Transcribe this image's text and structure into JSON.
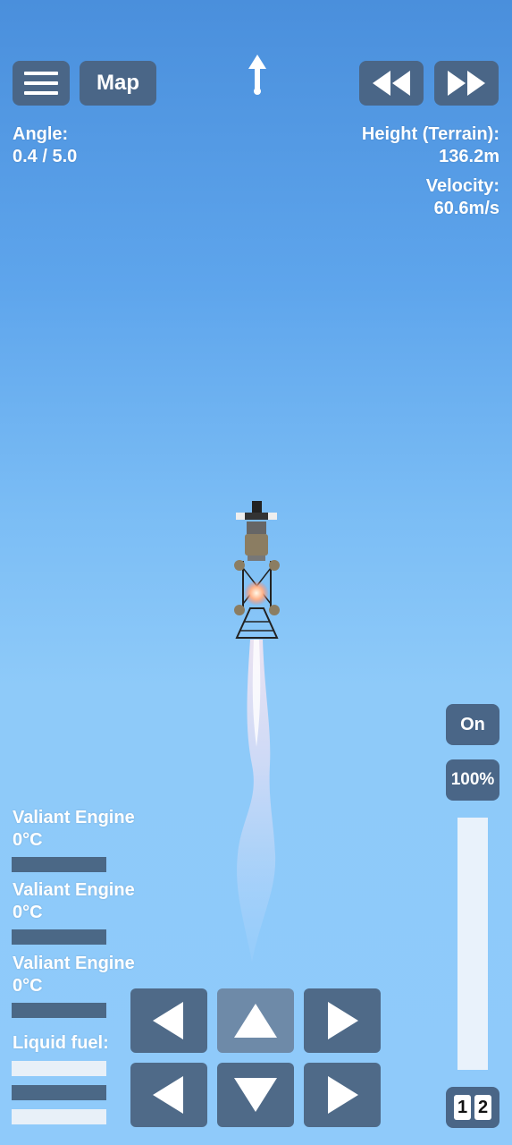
{
  "top_bar": {
    "menu_icon": "hamburger-menu-icon",
    "map_label": "Map",
    "heading_icon": "heading-arrow-up-icon",
    "rewind_icon": "rewind-icon",
    "fast_forward_icon": "fast-forward-icon"
  },
  "telemetry": {
    "angle_label": "Angle:",
    "angle_value": "0.4 / 5.0",
    "height_label": "Height (Terrain):",
    "height_value": "136.2m",
    "velocity_label": "Velocity:",
    "velocity_value": "60.6m/s"
  },
  "engine_panel": {
    "engines": [
      {
        "name": "Valiant Engine",
        "temp": "0°C"
      },
      {
        "name": "Valiant Engine",
        "temp": "0°C"
      },
      {
        "name": "Valiant Engine",
        "temp": "0°C"
      }
    ],
    "fuel_label": "Liquid fuel:"
  },
  "throttle": {
    "toggle_label": "On",
    "percent_label": "100%",
    "level": 1.0
  },
  "stage_switch": {
    "stage_1": "1",
    "stage_2": "2"
  },
  "controls": {
    "top_row": [
      "rotate-left-icon",
      "thrust-up-icon",
      "rotate-right-icon"
    ],
    "bottom_row": [
      "move-left-icon",
      "move-down-icon",
      "move-right-icon"
    ]
  },
  "colors": {
    "button_bg": "#4a6687",
    "sky_top": "#4a8fdc",
    "sky_bottom": "#8fcafa"
  }
}
